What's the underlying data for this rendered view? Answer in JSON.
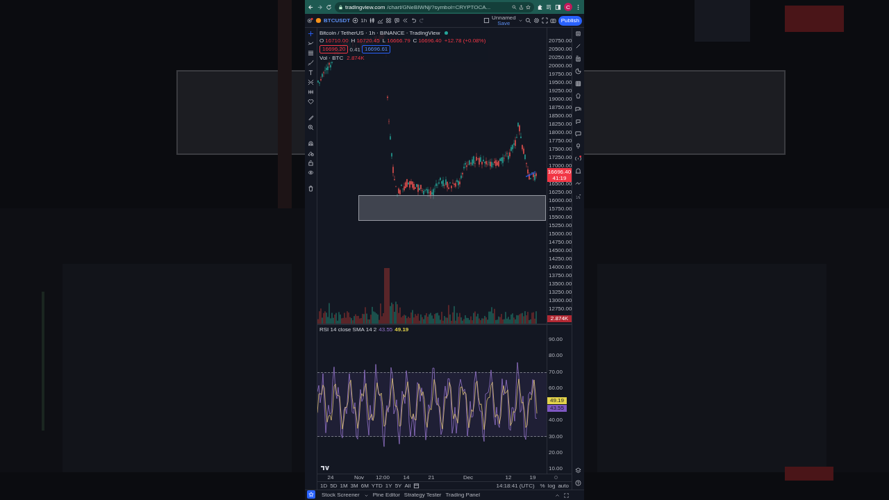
{
  "browser": {
    "url_domain": "tradingview.com",
    "url_path": "/chart/GNeBIWNj/?symbol=CRYPTOCA...",
    "avatar": "C"
  },
  "toolbar": {
    "symbol": "BTCUSDT",
    "interval": "1h",
    "layout_name": "Unnamed",
    "layout_status": "Save",
    "publish": "Publish"
  },
  "legend": {
    "title": "Bitcoin / TetherUS · 1h · BINANCE · TradingView",
    "ohlc": [
      {
        "label": "O",
        "value": "16710.00"
      },
      {
        "label": "H",
        "value": "16720.45"
      },
      {
        "label": "L",
        "value": "16666.79"
      },
      {
        "label": "C",
        "value": "16696.40"
      }
    ],
    "change": "+12.78 (+0.08%)",
    "sell": "16696.20",
    "spread": "0.41",
    "buy": "16696.61",
    "volume_label": "Vol · BTC",
    "volume_value": "2.874K"
  },
  "price_axis": {
    "upper_ticks": [
      "20750.00",
      "20500.00",
      "20250.00",
      "20000.00",
      "19750.00",
      "19500.00",
      "19250.00",
      "19000.00",
      "18750.00",
      "18500.00",
      "18250.00",
      "18000.00",
      "17750.00",
      "17500.00",
      "17250.00",
      "17000.00"
    ],
    "lower_ticks": [
      "16500.00",
      "16250.00",
      "16000.00",
      "15750.00",
      "15500.00",
      "15250.00",
      "15000.00",
      "14750.00",
      "14500.00",
      "14250.00",
      "14000.00",
      "13750.00",
      "13500.00",
      "13250.00",
      "13000.00",
      "12750.00"
    ],
    "price_tag": "16696.40",
    "countdown": "41:19",
    "volume_tag": "2.874K"
  },
  "rsi": {
    "legend": "RSI 14 close SMA 14 2",
    "value_sma": "43.55",
    "value_rsi": "49.19",
    "upper_ticks": [
      "90.00",
      "80.00",
      "70.00",
      "60.00"
    ],
    "tags": [
      {
        "text": "49.19",
        "color": "#e3d34b"
      },
      {
        "text": "43.55",
        "color": "#7e57c2"
      }
    ],
    "lower_ticks": [
      "40.00",
      "30.00",
      "20.00",
      "10.00"
    ]
  },
  "time_axis": [
    "24",
    "Nov",
    "12:00",
    "14",
    "21",
    "Dec",
    "12",
    "19"
  ],
  "timeframes": [
    "1D",
    "5D",
    "1M",
    "3M",
    "6M",
    "YTD",
    "1Y",
    "5Y",
    "All"
  ],
  "clock": "14:18:41 (UTC)",
  "scale_options": [
    "%",
    "log",
    "auto"
  ],
  "bottom_tabs": [
    "Stock Screener",
    "Pine Editor",
    "Strategy Tester",
    "Trading Panel"
  ]
}
